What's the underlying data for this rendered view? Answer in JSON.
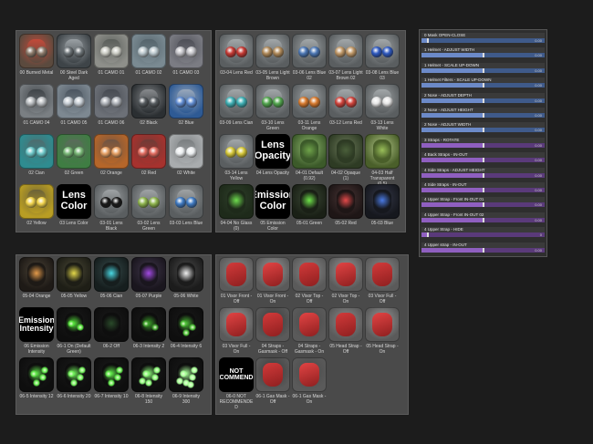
{
  "panels": {
    "top_left": {
      "items": [
        {
          "caption": "00 Burned Metal",
          "style": "metal-burn"
        },
        {
          "caption": "00 Steel Dark Aged",
          "style": "metal-dark"
        },
        {
          "caption": "01 CAMO 01",
          "style": "camo-a"
        },
        {
          "caption": "01 CAMO 02",
          "style": "camo-b"
        },
        {
          "caption": "01 CAMO 03",
          "style": "camo-c"
        },
        {
          "caption": "01 CAMO 04",
          "style": "camo-d"
        },
        {
          "caption": "01 CAMO 05",
          "style": "camo-e"
        },
        {
          "caption": "01 CAMO 06",
          "style": "camo-f"
        },
        {
          "caption": "02 Black",
          "style": "paint-black"
        },
        {
          "caption": "02 Blue",
          "style": "paint-blue"
        },
        {
          "caption": "02 Cian",
          "style": "paint-cyan"
        },
        {
          "caption": "02 Green",
          "style": "paint-green"
        },
        {
          "caption": "02 Orange",
          "style": "paint-orange"
        },
        {
          "caption": "02 Red",
          "style": "paint-red"
        },
        {
          "caption": "02 White",
          "style": "paint-white"
        },
        {
          "caption": "02 Yellow",
          "style": "paint-yellow"
        },
        {
          "caption": "03 Lens Color",
          "label": "Lens Color"
        },
        {
          "caption": "03-01 Lens Black",
          "style": "lens-black"
        },
        {
          "caption": "03-02 Lens Green",
          "style": "lens-green"
        },
        {
          "caption": "03-03 Lens Blue",
          "style": "lens-blue"
        }
      ]
    },
    "top_mid": {
      "items": [
        {
          "caption": "03-04 Lens Red",
          "style": "lens-red"
        },
        {
          "caption": "03-05 Lens Light Brown",
          "style": "lens-brown"
        },
        {
          "caption": "03-06 Lens Blue 02",
          "style": "lens-blue2"
        },
        {
          "caption": "03-07 Lens Light Brown 02",
          "style": "lens-brown2"
        },
        {
          "caption": "03-08 Lens Blue 03",
          "style": "lens-blue3"
        },
        {
          "caption": "03-09 Lens Cian",
          "style": "lens-cyan"
        },
        {
          "caption": "03-10 Lens Green",
          "style": "lens-green2"
        },
        {
          "caption": "03-11 Lens Orange",
          "style": "lens-orange"
        },
        {
          "caption": "03-12 Lens Red",
          "style": "lens-red2"
        },
        {
          "caption": "03-13 Lens White",
          "style": "lens-white"
        },
        {
          "caption": "03-14 Lens Yellow",
          "style": "lens-yellow"
        },
        {
          "caption": "04 Lens Opacity",
          "label": "Lens Opacity"
        },
        {
          "caption": "04-01 Default (0.92)",
          "style": "op-default"
        },
        {
          "caption": "04-02 Opaque (1)",
          "style": "op-opaque"
        },
        {
          "caption": "04-03 Half Transparent (0.5)",
          "style": "op-half"
        },
        {
          "caption": "04-04 No Glass (0)",
          "style": "op-none"
        },
        {
          "caption": "05 Emission Color",
          "label": "Emission Color"
        },
        {
          "caption": "05-01 Green",
          "style": "em-green"
        },
        {
          "caption": "05-02 Red",
          "style": "em-red"
        },
        {
          "caption": "05-03 Blue",
          "style": "em-blue"
        }
      ]
    },
    "bottom_left": {
      "items": [
        {
          "caption": "05-04 Orange",
          "style": "em-orange"
        },
        {
          "caption": "05-05 Yellow",
          "style": "em-yellow"
        },
        {
          "caption": "05-06 Cian",
          "style": "em-cyan"
        },
        {
          "caption": "05-07 Purple",
          "style": "em-purple"
        },
        {
          "caption": "05-06 White",
          "style": "em-white"
        },
        {
          "caption": "06 Emission Intensity",
          "label": "Emission Intensity"
        },
        {
          "caption": "06-1 On (Default Green)",
          "style": "int-1"
        },
        {
          "caption": "06-2 Off",
          "style": "int-off"
        },
        {
          "caption": "06-3 Intensity 2",
          "style": "int-2"
        },
        {
          "caption": "06-4 Intensity 6",
          "style": "int-3"
        },
        {
          "caption": "06-5 Intensity 12",
          "style": "int-4"
        },
        {
          "caption": "06-6 Intensity 20",
          "style": "int-5"
        },
        {
          "caption": "06-7 Intensity 10",
          "style": "int-4"
        },
        {
          "caption": "06-8 Intensity 150",
          "style": "int-6"
        },
        {
          "caption": "06-9 Intensity 300",
          "style": "int-7"
        }
      ]
    },
    "bottom_mid": {
      "items": [
        {
          "caption": "01 Visor Front - Off",
          "style": "red-helmet"
        },
        {
          "caption": "01 Visor Front - On",
          "style": "red-helmet-on"
        },
        {
          "caption": "02 Visor Top - Off",
          "style": "red-helmet"
        },
        {
          "caption": "02 Visor Top - On",
          "style": "red-helmet-on"
        },
        {
          "caption": "03 Visor Full - Off",
          "style": "red-helmet"
        },
        {
          "caption": "03 Visor Full - On",
          "style": "red-helmet-on"
        },
        {
          "caption": "04 Straps - Gasmask - Off",
          "style": "red-mask"
        },
        {
          "caption": "04 Straps - Gasmask - On",
          "style": "red-mask-on"
        },
        {
          "caption": "05 Head Strap - Off",
          "style": "red-helmet"
        },
        {
          "caption": "05 Head Strap - On",
          "style": "red-helmet-on"
        },
        {
          "caption": "06-0 NOT RECOMMENDED",
          "label": "NOT RECOMMENDED"
        },
        {
          "caption": "06-1 Gas Mask - Off",
          "style": "red-mask"
        },
        {
          "caption": "06-1 Gas Mask - On",
          "style": "red-mask-on"
        }
      ]
    }
  },
  "sliders": [
    {
      "label": "0 Mask OPEN-CLOSE",
      "value": 0.05,
      "display": "0.00",
      "track": "blue"
    },
    {
      "label": "1 Helmet - ADJUST WIDTH",
      "value": 0.5,
      "display": "0.00",
      "track": "blue"
    },
    {
      "label": "1 Helmet - SCALE UP-DOWN",
      "value": 0.5,
      "display": "0.00",
      "track": "blue"
    },
    {
      "label": "1 Helmet Filters - SCALE UP-DOWN",
      "value": 0.5,
      "display": "0.00",
      "track": "blue"
    },
    {
      "label": "2 Nose - ADJUST DEPTH",
      "value": 0.5,
      "display": "0.00",
      "track": "blue"
    },
    {
      "label": "2 Nose - ADJUST HEIGHT",
      "value": 0.5,
      "display": "0.00",
      "track": "blue"
    },
    {
      "label": "2 Nose - ADJUST WIDTH",
      "value": 0.5,
      "display": "0.00",
      "track": "blue"
    },
    {
      "label": "3 Straps - ROTATE",
      "value": 0.5,
      "display": "0.00",
      "track": "purple"
    },
    {
      "label": "4 Back Straps - IN-OUT",
      "value": 0.5,
      "display": "0.00",
      "track": "purple"
    },
    {
      "label": "4 Side Straps - ADJUST HEIGHT",
      "value": 0.5,
      "display": "0.00",
      "track": "purple"
    },
    {
      "label": "4 Side Straps - IN-OUT",
      "value": 0.5,
      "display": "0.00",
      "track": "purple"
    },
    {
      "label": "4 Upper Strap - Front IN-OUT 01",
      "value": 0.5,
      "display": "0.00",
      "track": "purple"
    },
    {
      "label": "4 Upper Strap - Front IN-OUT 02",
      "value": 0.5,
      "display": "0.00",
      "track": "purple"
    },
    {
      "label": "4 Upper Strap - HIDE",
      "value": 0.05,
      "display": "0",
      "track": "purple"
    },
    {
      "label": "4 Upper strap - IN-OUT",
      "value": 0.5,
      "display": "0.00",
      "track": "purple"
    }
  ]
}
